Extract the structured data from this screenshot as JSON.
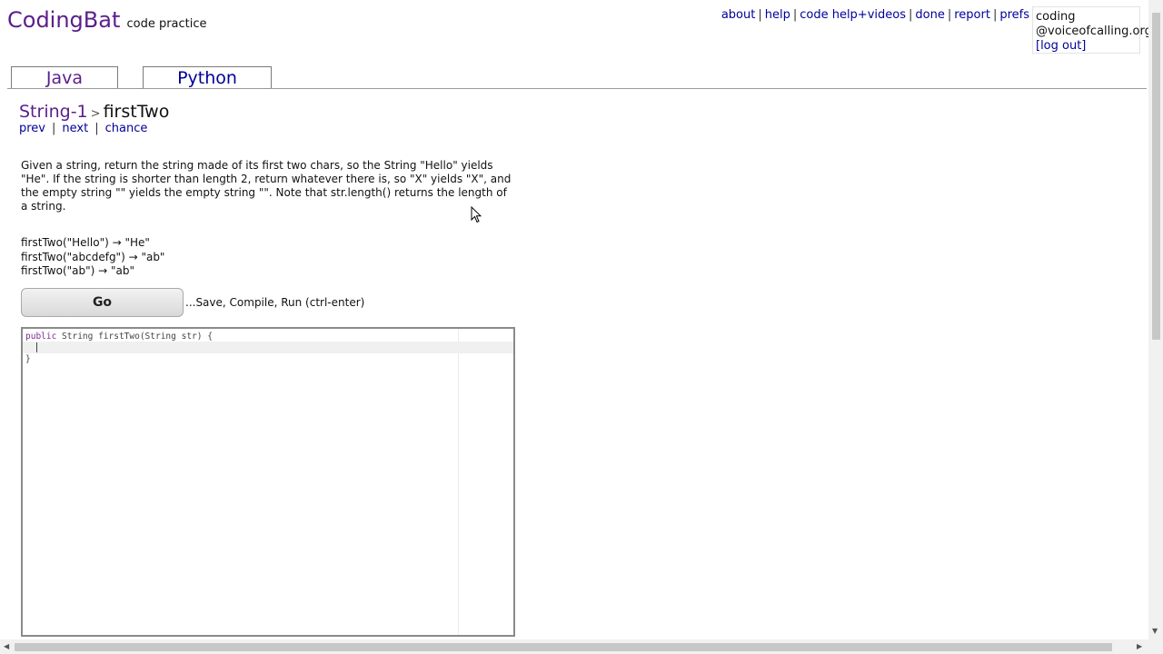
{
  "header": {
    "brand_name": "CodingBat",
    "brand_sub": "code practice",
    "nav": [
      "about",
      "help",
      "code help+videos",
      "done",
      "report",
      "prefs"
    ],
    "separator": "|"
  },
  "user": {
    "line1": "coding",
    "line2": "@voiceofcalling.org",
    "logout_label": "[log out]"
  },
  "tabs": {
    "java": "Java",
    "python": "Python"
  },
  "problem": {
    "section": "String-1",
    "arrow": ">",
    "title": "firstTwo",
    "nav": {
      "prev": "prev",
      "next": "next",
      "chance": "chance",
      "separator": "|"
    },
    "description": "Given a string, return the string made of its first two chars, so the String \"Hello\" yields \"He\". If the string is shorter than length 2, return whatever there is, so \"X\" yields \"X\", and the empty string \"\" yields the empty string \"\". Note that str.length() returns the length of a string.",
    "examples": [
      "firstTwo(\"Hello\") → \"He\"",
      "firstTwo(\"abcdefg\") → \"ab\"",
      "firstTwo(\"ab\") → \"ab\""
    ]
  },
  "run": {
    "go_label": "Go",
    "hint": "...Save, Compile, Run (ctrl-enter)"
  },
  "editor": {
    "line1_kw": "public",
    "line1_rest": " String firstTwo(String str) {",
    "line3": "}"
  },
  "colors": {
    "brand": "#5a1f8c",
    "link": "#000099"
  },
  "icons": {
    "mouse": "arrow-pointer-icon",
    "scroll_down": "triangle-down-icon",
    "scroll_left": "triangle-left-icon",
    "scroll_right": "triangle-right-icon"
  }
}
